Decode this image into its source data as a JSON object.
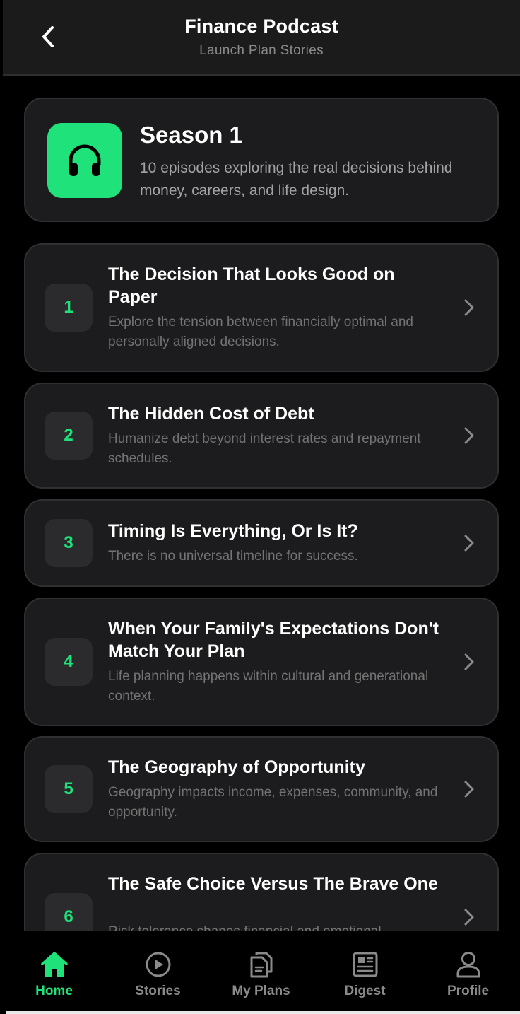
{
  "header": {
    "title": "Finance Podcast",
    "subtitle": "Launch Plan Stories"
  },
  "season": {
    "title": "Season 1",
    "description": "10 episodes exploring the real decisions behind money, careers, and life design.",
    "icon": "headphones-icon"
  },
  "episodes": [
    {
      "number": "1",
      "title": "The Decision That Looks Good on Paper",
      "description": "Explore the tension between financially optimal and personally aligned decisions."
    },
    {
      "number": "2",
      "title": "The Hidden Cost of Debt",
      "description": "Humanize debt beyond interest rates and repayment schedules."
    },
    {
      "number": "3",
      "title": "Timing Is Everything, Or Is It?",
      "description": "There is no universal timeline for success."
    },
    {
      "number": "4",
      "title": "When Your Family's Expectations Don't Match Your Plan",
      "description": "Life planning happens within cultural and generational context."
    },
    {
      "number": "5",
      "title": "The Geography of Opportunity",
      "description": "Geography impacts income, expenses, community, and opportunity."
    },
    {
      "number": "6",
      "title": "The Safe Choice Versus The Brave One",
      "description": "Risk tolerance shapes financial and emotional"
    }
  ],
  "tabs": [
    {
      "label": "Home",
      "icon": "home-icon",
      "active": true
    },
    {
      "label": "Stories",
      "icon": "play-circle-icon",
      "active": false
    },
    {
      "label": "My Plans",
      "icon": "documents-icon",
      "active": false
    },
    {
      "label": "Digest",
      "icon": "newspaper-icon",
      "active": false
    },
    {
      "label": "Profile",
      "icon": "person-icon",
      "active": false
    }
  ],
  "colors": {
    "accent": "#1fe27a",
    "background": "#000000",
    "card": "#1c1c1e",
    "muted_text": "#737373"
  }
}
